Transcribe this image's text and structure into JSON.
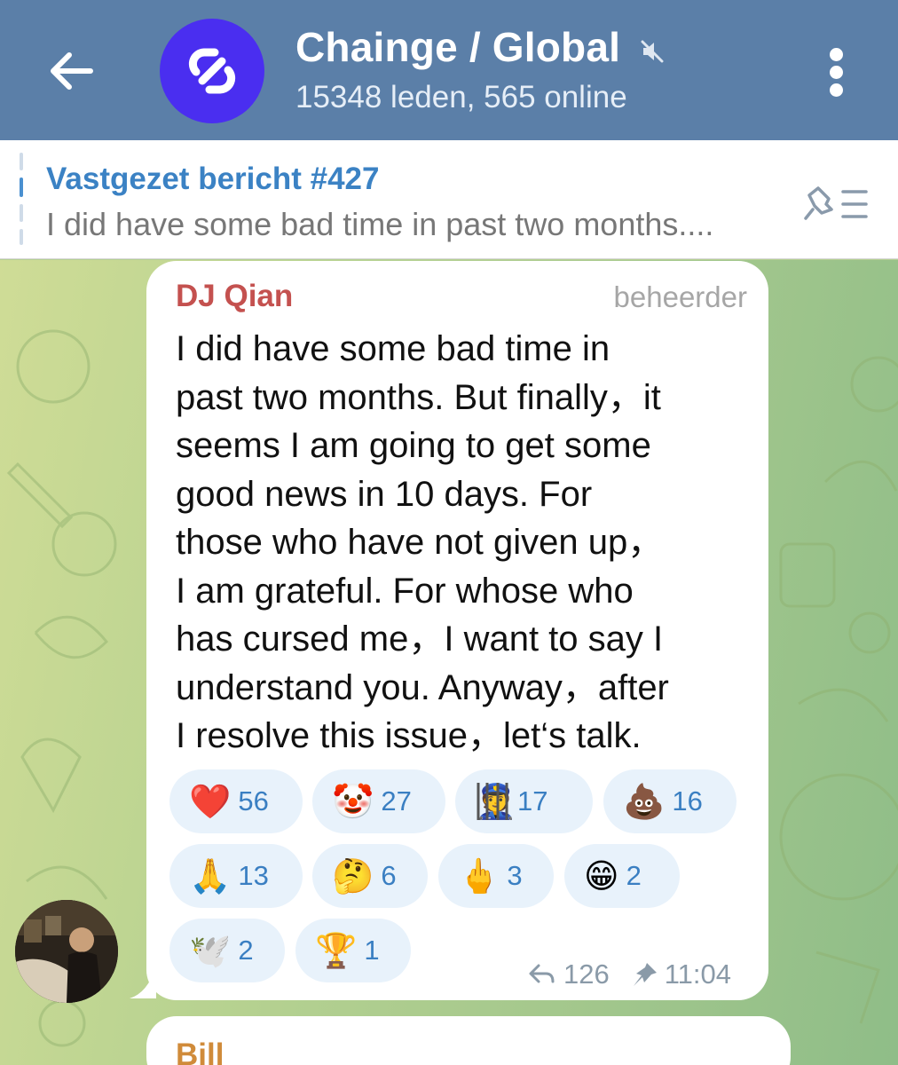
{
  "header": {
    "title": "Chainge / Global",
    "subtitle": "15348 leden, 565 online"
  },
  "pinned": {
    "title": "Vastgezet bericht #427",
    "text": "I did have some bad time in past two months...."
  },
  "message": {
    "sender": "DJ Qian",
    "role": "beheerder",
    "lines": [
      "I did have some bad time in",
      "past two months. But finally，it",
      "seems I am going to get some",
      "good news in 10 days. For",
      "those who have not given up，",
      "I am grateful. For whose who",
      "has cursed me，I want to say I",
      "understand you. Anyway，after",
      "I resolve this issue，let‘s talk."
    ],
    "reactions": [
      {
        "emoji": "❤️",
        "count": "56",
        "icon": "heart-icon"
      },
      {
        "emoji": "🤡",
        "count": "27",
        "icon": "clown-icon"
      },
      {
        "emoji": "👮",
        "count": "17",
        "icon": "jail-face-icon"
      },
      {
        "emoji": "💩",
        "count": "16",
        "icon": "poop-icon"
      },
      {
        "emoji": "🙏",
        "count": "13",
        "icon": "praying-hands-icon"
      },
      {
        "emoji": "🤔",
        "count": "6",
        "icon": "thinking-face-icon"
      },
      {
        "emoji": "🖕",
        "count": "3",
        "icon": "middle-finger-icon"
      },
      {
        "emoji": "😁",
        "count": "2",
        "icon": "grinning-face-icon"
      },
      {
        "emoji": "🕊️",
        "count": "2",
        "icon": "dove-icon"
      },
      {
        "emoji": "🏆",
        "count": "1",
        "icon": "trophy-icon"
      }
    ],
    "forwards": "126",
    "time": "11:04"
  },
  "next_message": {
    "sender": "Bill"
  },
  "colors": {
    "header": "#5b7fa8",
    "channel_avatar": "#4a2ef0",
    "sender": "#c4514f",
    "accent": "#3b82c4",
    "reaction_bg": "#e8f2fb"
  }
}
